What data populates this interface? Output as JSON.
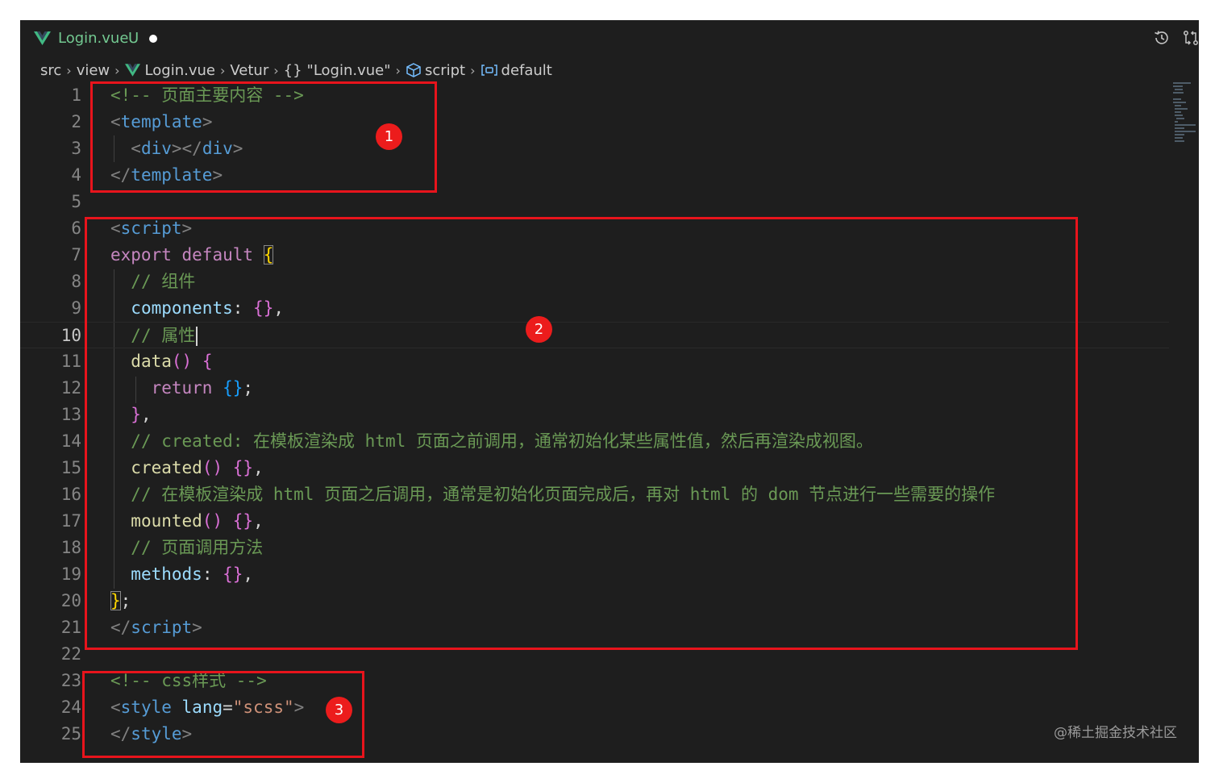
{
  "tab": {
    "file_name": "Login.vue",
    "git_status": "U",
    "logo_icon": "vue-logo-icon",
    "modified_indicator": "dot"
  },
  "toolbar": {
    "history_icon": "timeline-history-icon",
    "compare_icon": "open-changes-icon"
  },
  "breadcrumb": {
    "items": [
      "src",
      "view",
      "Login.vue",
      "Vetur",
      "\"Login.vue\"",
      "script",
      "default"
    ],
    "braces_glyph": "{}"
  },
  "editor": {
    "current_line": 10,
    "lines": [
      {
        "number": "1"
      },
      {
        "number": "2"
      },
      {
        "number": "3"
      },
      {
        "number": "4"
      },
      {
        "number": "5"
      },
      {
        "number": "6"
      },
      {
        "number": "7"
      },
      {
        "number": "8"
      },
      {
        "number": "9"
      },
      {
        "number": "10"
      },
      {
        "number": "11"
      },
      {
        "number": "12"
      },
      {
        "number": "13"
      },
      {
        "number": "14"
      },
      {
        "number": "15"
      },
      {
        "number": "16"
      },
      {
        "number": "17"
      },
      {
        "number": "18"
      },
      {
        "number": "19"
      },
      {
        "number": "20"
      },
      {
        "number": "21"
      },
      {
        "number": "22"
      },
      {
        "number": "23"
      },
      {
        "number": "24"
      },
      {
        "number": "25"
      }
    ],
    "code": {
      "l1_comment": "<!-- 页面主要内容 -->",
      "l2_open": "<",
      "l2_tag": "template",
      "l2_close": ">",
      "l3_open1": "<",
      "l3_tag1": "div",
      "l3_mid": "></",
      "l3_tag2": "div",
      "l3_close": ">",
      "l4_open": "</",
      "l4_tag": "template",
      "l4_close": ">",
      "l6_open": "<",
      "l6_tag": "script",
      "l6_close": ">",
      "l7_kw1": "export",
      "l7_kw2": "default",
      "l7_brace": "{",
      "l8_comment": "// 组件",
      "l9_prop": "components",
      "l9_colon": ":",
      "l9_obj": "{}",
      "l9_comma": ",",
      "l10_comment": "// 属性",
      "l11_fn": "data",
      "l11_parens": "()",
      "l11_brace": "{",
      "l12_kw": "return",
      "l12_obj": "{}",
      "l12_semi": ";",
      "l13_brace": "}",
      "l13_comma": ",",
      "l14_comment": "// created: 在模板渲染成 html 页面之前调用，通常初始化某些属性值，然后再渲染成视图。",
      "l15_fn": "created",
      "l15_parens": "()",
      "l15_obj": "{}",
      "l15_comma": ",",
      "l16_comment": "// 在模板渲染成 html 页面之后调用，通常是初始化页面完成后，再对 html 的 dom 节点进行一些需要的操作",
      "l17_fn": "mounted",
      "l17_parens": "()",
      "l17_obj": "{}",
      "l17_comma": ",",
      "l18_comment": "// 页面调用方法",
      "l19_prop": "methods",
      "l19_colon": ":",
      "l19_obj": "{}",
      "l19_comma": ",",
      "l20_brace": "}",
      "l20_semi": ";",
      "l21_open": "</",
      "l21_tag": "script",
      "l21_close": ">",
      "l23_comment": "<!-- css样式 -->",
      "l24_open": "<",
      "l24_tag": "style",
      "l24_attr": "lang",
      "l24_eq": "=",
      "l24_val": "\"scss\"",
      "l24_close": ">",
      "l25_open": "</",
      "l25_tag": "style",
      "l25_close": ">"
    }
  },
  "annotations": {
    "badges": [
      "1",
      "2",
      "3"
    ],
    "color": "#e8141c"
  },
  "watermark": "@稀土掘金技术社区",
  "colors": {
    "background": "#1e1e1e",
    "comment": "#6a9955",
    "tag": "#569cd6",
    "keyword": "#c586c0",
    "function": "#dcdcaa",
    "property": "#9cdcfe",
    "string": "#ce9178",
    "bracket_gold": "#ffd700",
    "bracket_orchid": "#da70d6",
    "bracket_blue": "#179fff",
    "git_untracked": "#73c991"
  }
}
